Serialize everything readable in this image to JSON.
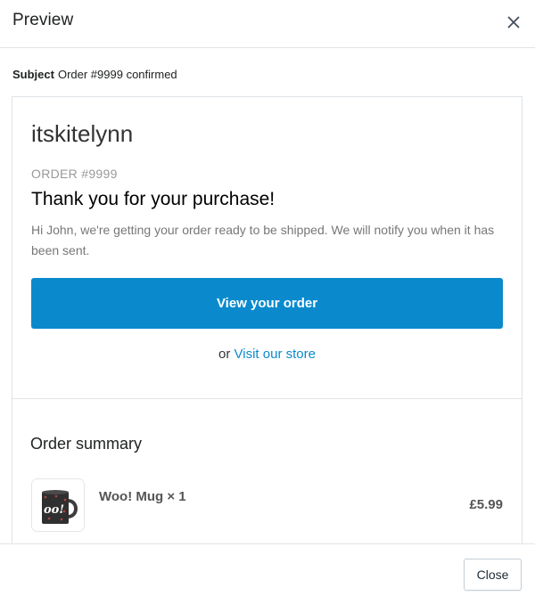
{
  "modal": {
    "title": "Preview",
    "close_icon": "close-icon"
  },
  "subject": {
    "label": "Subject",
    "value": "Order #9999 confirmed"
  },
  "email": {
    "shop_name": "itskitelynn",
    "order_number": "ORDER #9999",
    "heading": "Thank you for your purchase!",
    "message": "Hi John, we're getting your order ready to be shipped. We will notify you when it has been sent.",
    "view_order_label": "View your order",
    "or_text": "or",
    "visit_store_label": "Visit our store",
    "accent_color": "#0a8acd",
    "summary": {
      "title": "Order summary",
      "items": [
        {
          "name": "Woo! Mug × 1",
          "price": "£5.99",
          "thumbnail_icon": "mug-image"
        }
      ]
    }
  },
  "footer": {
    "close_label": "Close"
  }
}
